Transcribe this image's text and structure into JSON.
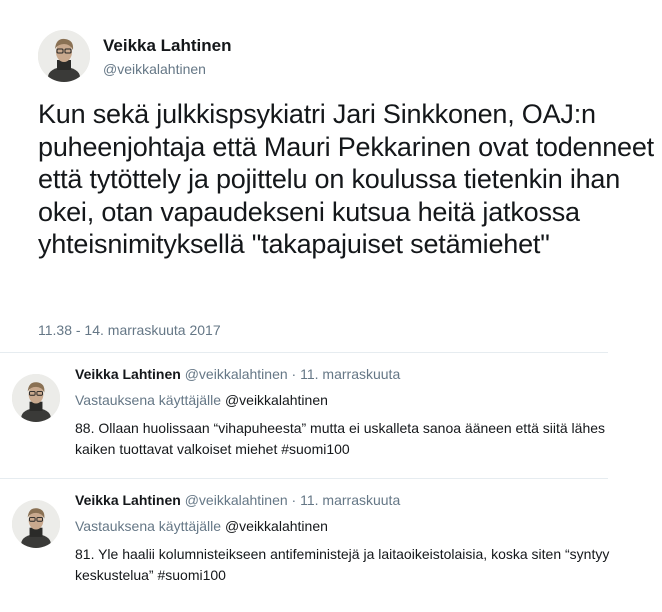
{
  "main_tweet": {
    "author_name": "Veikka Lahtinen",
    "author_handle": "@veikkalahtinen",
    "text": "Kun sekä julkkispsykiatri Jari Sinkkonen, OAJ:n puheenjohtaja että Mauri Pekkarinen ovat todenneet että tytöttely ja pojittelu on koulussa tietenkin ihan okei, otan vapaudekseni kutsua heitä jatkossa yhteisnimityksellä \"takapajuiset setämiehet\"",
    "timestamp": "11.38 - 14. marraskuuta 2017"
  },
  "replies": [
    {
      "author_name": "Veikka Lahtinen",
      "author_handle": "@veikkalahtinen",
      "separator": "·",
      "date": "11. marraskuuta",
      "reply_context_prefix": "Vastauksena käyttäjälle",
      "reply_context_mention": "@veikkalahtinen",
      "text": "88. Ollaan huolissaan “vihapuheesta” mutta ei uskalleta sanoa ääneen että siitä lähes kaiken tuottavat valkoiset miehet #suomi100"
    },
    {
      "author_name": "Veikka Lahtinen",
      "author_handle": "@veikkalahtinen",
      "separator": "·",
      "date": "11. marraskuuta",
      "reply_context_prefix": "Vastauksena käyttäjälle",
      "reply_context_mention": "@veikkalahtinen",
      "text": "81. Yle haalii kolumnisteikseen antifeministejä ja laitaoikeistolaisia, koska siten “syntyy keskustelua” #suomi100"
    }
  ],
  "icons": {
    "avatar": "profile-photo"
  }
}
